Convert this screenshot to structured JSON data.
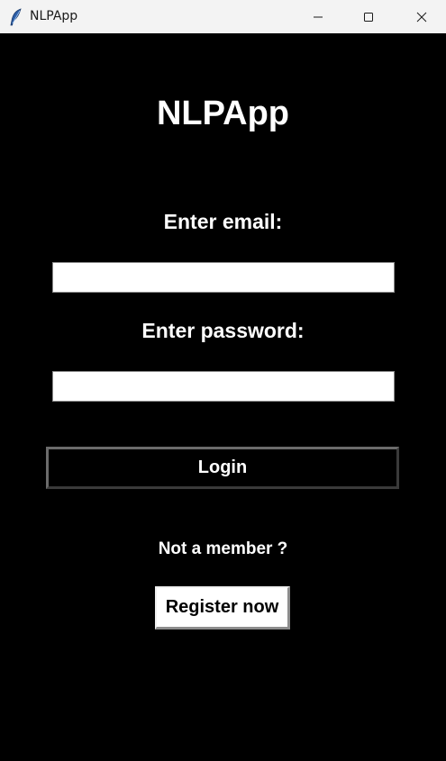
{
  "window": {
    "title": "NLPApp",
    "icon": "feather-icon"
  },
  "controls": {
    "minimize_icon": "minimize-icon",
    "maximize_icon": "maximize-icon",
    "close_icon": "close-icon"
  },
  "login_form": {
    "heading": "NLPApp",
    "email_label": "Enter email:",
    "email_value": "",
    "password_label": "Enter password:",
    "password_value": "",
    "login_button": "Login"
  },
  "register": {
    "prompt": "Not a member ?",
    "button": "Register now"
  },
  "colors": {
    "background": "#000000",
    "text": "#ffffff",
    "titlebar": "#f3f3f3"
  }
}
